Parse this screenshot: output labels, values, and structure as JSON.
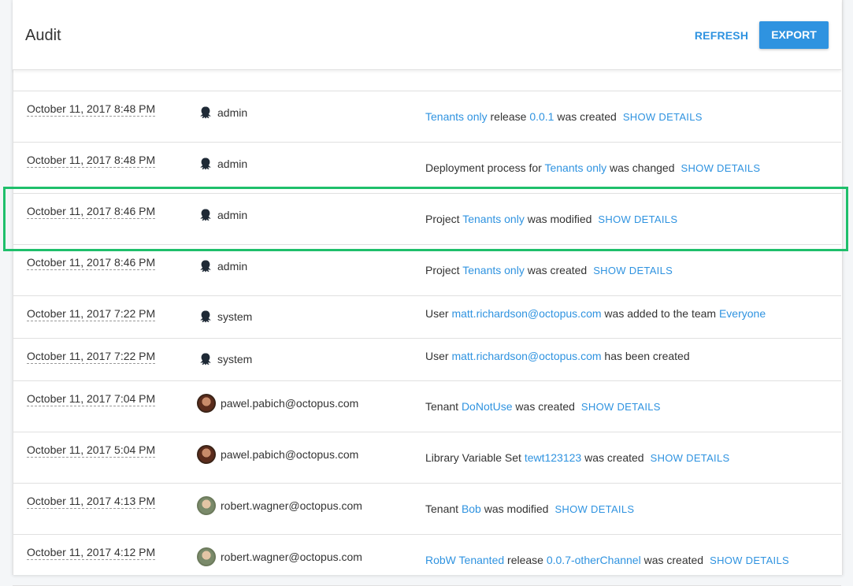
{
  "header": {
    "title": "Audit",
    "refresh_label": "REFRESH",
    "export_label": "EXPORT"
  },
  "colors": {
    "accent": "#2f93e0",
    "highlight": "#1fbf6b"
  },
  "rows": [
    {
      "date": "October 11, 2017 8:48 PM",
      "user": "admin",
      "avatar": "octopus-icon",
      "msg": [
        {
          "t": "Tenants only",
          "link": true
        },
        {
          "t": " release "
        },
        {
          "t": "0.0.1",
          "link": true
        },
        {
          "t": " was created"
        }
      ],
      "details": "SHOW DETAILS"
    },
    {
      "date": "October 11, 2017 8:48 PM",
      "user": "admin",
      "avatar": "octopus-icon",
      "msg": [
        {
          "t": "Deployment process for "
        },
        {
          "t": "Tenants only",
          "link": true
        },
        {
          "t": " was changed"
        }
      ],
      "details": "SHOW DETAILS"
    },
    {
      "date": "October 11, 2017 8:46 PM",
      "user": "admin",
      "avatar": "octopus-icon",
      "msg": [
        {
          "t": "Project "
        },
        {
          "t": "Tenants only",
          "link": true
        },
        {
          "t": " was modified"
        }
      ],
      "details": "SHOW DETAILS"
    },
    {
      "date": "October 11, 2017 8:46 PM",
      "user": "admin",
      "avatar": "octopus-icon",
      "msg": [
        {
          "t": "Project "
        },
        {
          "t": "Tenants only",
          "link": true
        },
        {
          "t": " was created"
        }
      ],
      "details": "SHOW DETAILS"
    },
    {
      "date": "October 11, 2017 7:22 PM",
      "user": "system",
      "avatar": "octopus-icon",
      "msg": [
        {
          "t": "User "
        },
        {
          "t": "matt.richardson@octopus.com",
          "link": true
        },
        {
          "t": " was added to the team "
        },
        {
          "t": "Everyone",
          "link": true
        }
      ],
      "details": ""
    },
    {
      "date": "October 11, 2017 7:22 PM",
      "user": "system",
      "avatar": "octopus-icon",
      "msg": [
        {
          "t": "User "
        },
        {
          "t": "matt.richardson@octopus.com",
          "link": true
        },
        {
          "t": " has been created"
        }
      ],
      "details": ""
    },
    {
      "date": "October 11, 2017 7:04 PM",
      "user": "pawel.pabich@octopus.com",
      "avatar": "pawel",
      "msg": [
        {
          "t": "Tenant "
        },
        {
          "t": "DoNotUse",
          "link": true
        },
        {
          "t": " was created"
        }
      ],
      "details": "SHOW DETAILS"
    },
    {
      "date": "October 11, 2017 5:04 PM",
      "user": "pawel.pabich@octopus.com",
      "avatar": "pawel",
      "msg": [
        {
          "t": "Library Variable Set "
        },
        {
          "t": "tewt123123",
          "link": true
        },
        {
          "t": " was created"
        }
      ],
      "details": "SHOW DETAILS"
    },
    {
      "date": "October 11, 2017 4:13 PM",
      "user": "robert.wagner@octopus.com",
      "avatar": "robert",
      "msg": [
        {
          "t": "Tenant "
        },
        {
          "t": "Bob",
          "link": true
        },
        {
          "t": " was modified"
        }
      ],
      "details": "SHOW DETAILS"
    },
    {
      "date": "October 11, 2017 4:12 PM",
      "user": "robert.wagner@octopus.com",
      "avatar": "robert",
      "msg": [
        {
          "t": "RobW Tenanted",
          "link": true
        },
        {
          "t": " release "
        },
        {
          "t": "0.0.7-otherChannel",
          "link": true
        },
        {
          "t": " was created"
        }
      ],
      "details": "SHOW DETAILS"
    }
  ]
}
